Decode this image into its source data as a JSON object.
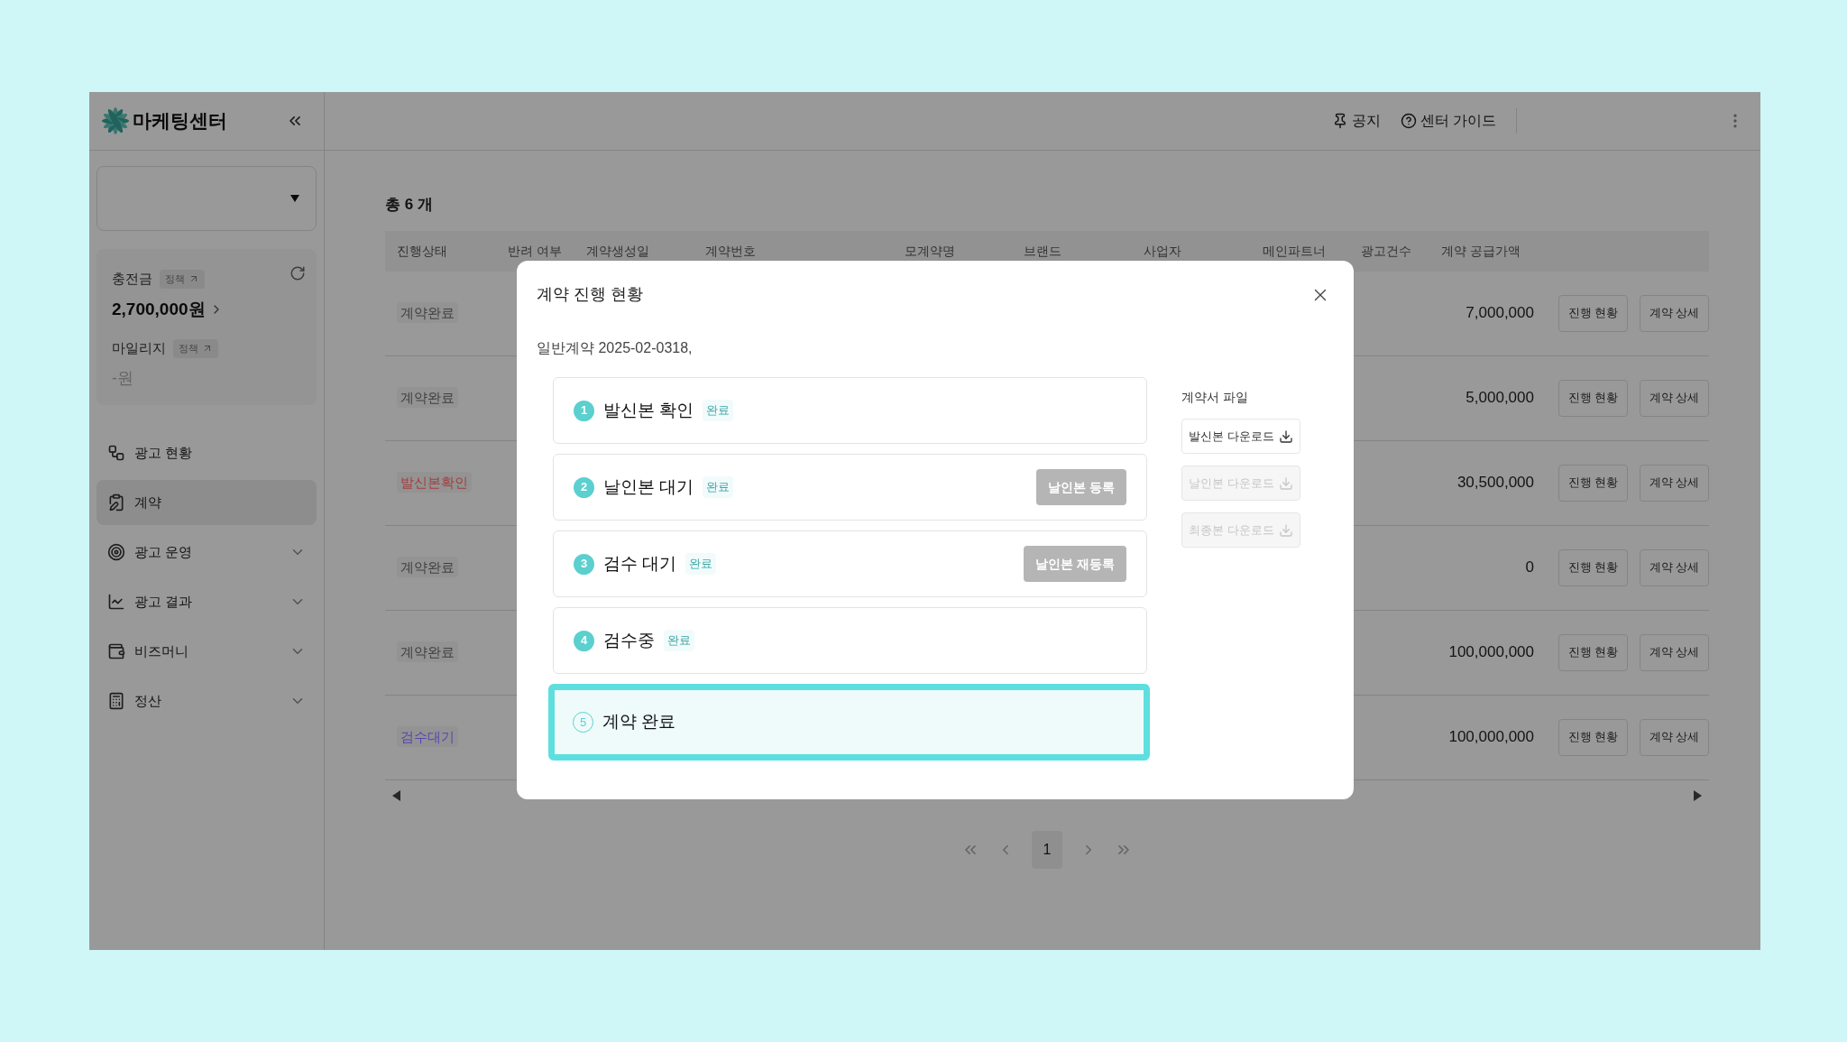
{
  "sidebar": {
    "title": "마케팅센터",
    "balance": {
      "label": "충전금",
      "policy": "정책",
      "amount": "2,700,000원"
    },
    "mileage": {
      "label": "마일리지",
      "policy": "정책",
      "amount": "-원"
    },
    "nav": [
      {
        "label": "광고 현황",
        "expandable": false,
        "selected": false
      },
      {
        "label": "계약",
        "expandable": false,
        "selected": true
      },
      {
        "label": "광고 운영",
        "expandable": true,
        "selected": false
      },
      {
        "label": "광고 결과",
        "expandable": true,
        "selected": false
      },
      {
        "label": "비즈머니",
        "expandable": true,
        "selected": false
      },
      {
        "label": "정산",
        "expandable": true,
        "selected": false
      }
    ]
  },
  "header": {
    "links": [
      "공지",
      "센터 가이드"
    ]
  },
  "table": {
    "total": "총 6 개",
    "columns": [
      "진행상태",
      "반려 여부",
      "계약생성일",
      "계약번호",
      "모계약명",
      "브랜드",
      "사업자",
      "메인파트너",
      "광고건수",
      "계약 공급가액"
    ],
    "rows": [
      {
        "status": {
          "text": "계약완료",
          "color": "#404040"
        },
        "amount": "7,000,000",
        "actions": [
          "진행 현황",
          "계약 상세"
        ]
      },
      {
        "status": {
          "text": "계약완료",
          "color": "#404040"
        },
        "amount": "5,000,000",
        "actions": [
          "진행 현황",
          "계약 상세"
        ]
      },
      {
        "status": {
          "text": "발신본확인",
          "color": "#a63d3d"
        },
        "amount": "30,500,000",
        "actions": [
          "진행 현황",
          "계약 상세"
        ]
      },
      {
        "status": {
          "text": "계약완료",
          "color": "#404040"
        },
        "amount": "0",
        "actions": [
          "진행 현황",
          "계약 상세"
        ]
      },
      {
        "status": {
          "text": "계약완료",
          "color": "#404040"
        },
        "amount": "100,000,000",
        "actions": [
          "진행 현황",
          "계약 상세"
        ]
      },
      {
        "status": {
          "text": "검수대기",
          "color": "#5a44b0"
        },
        "amount": "100,000,000",
        "actions": [
          "진행 현황",
          "계약 상세"
        ]
      }
    ]
  },
  "pagination": {
    "pages": [
      {
        "label": "1",
        "selected": true
      }
    ]
  },
  "modal": {
    "title": "계약 진행 현황",
    "subtitle": "일반계약 2025-02-0318,",
    "steps": [
      {
        "number": "1",
        "label": "발신본 확인",
        "status": "완료",
        "completed": true,
        "selected": false
      },
      {
        "number": "2",
        "label": "날인본 대기",
        "status": "완료",
        "completed": true,
        "selected": false,
        "action": {
          "label": "날인본 등록",
          "disabled": true
        }
      },
      {
        "number": "3",
        "label": "검수 대기",
        "status": "완료",
        "completed": true,
        "selected": false,
        "action": {
          "label": "날인본 재등록",
          "disabled": true
        }
      },
      {
        "number": "4",
        "label": "검수중",
        "status": "완료",
        "completed": true,
        "selected": false
      },
      {
        "number": "5",
        "label": "계약 완료",
        "completed": false,
        "selected": true
      }
    ],
    "files": {
      "label": "계약서 파일",
      "buttons": [
        {
          "label": "발신본 다운로드",
          "disabled": false
        },
        {
          "label": "날인본 다운로드",
          "disabled": true
        },
        {
          "label": "최종본 다운로드",
          "disabled": true
        }
      ]
    }
  }
}
